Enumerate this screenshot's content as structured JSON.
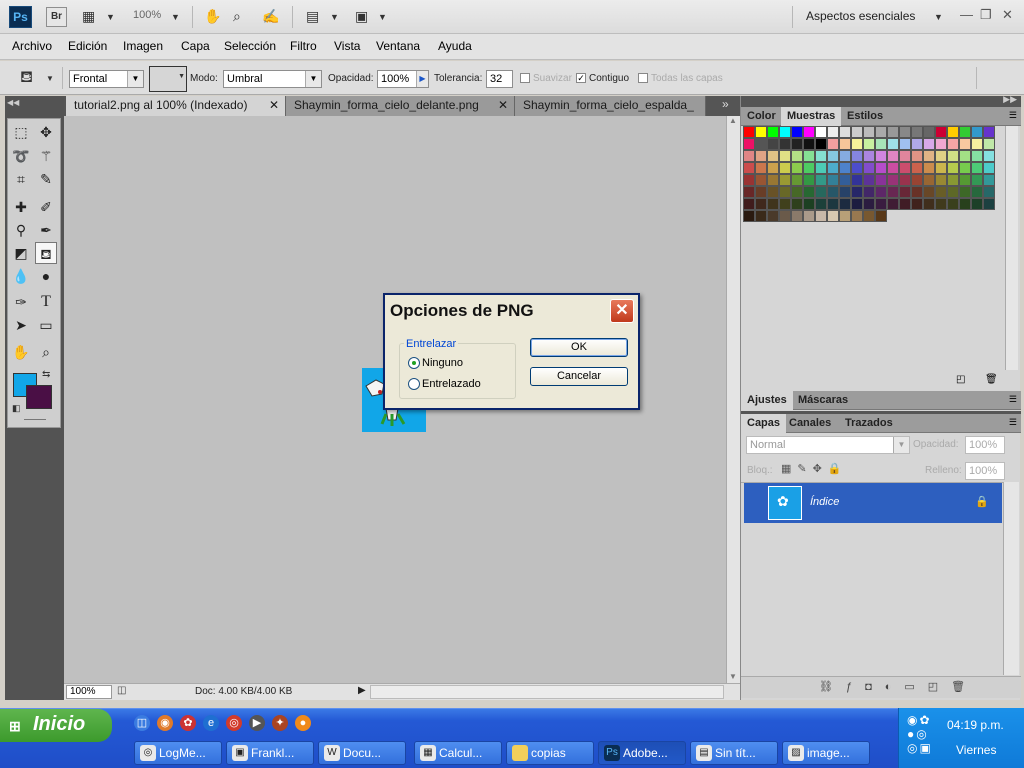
{
  "app": {
    "ps_badge": "Ps",
    "br_badge": "Br",
    "zoom": "100%",
    "workspace": "Aspectos esenciales"
  },
  "menu": [
    "Archivo",
    "Edición",
    "Imagen",
    "Capa",
    "Selección",
    "Filtro",
    "Vista",
    "Ventana",
    "Ayuda"
  ],
  "options": {
    "fill_source": "Frontal",
    "mode_label": "Modo:",
    "mode_value": "Umbral",
    "opacity_label": "Opacidad:",
    "opacity_value": "100%",
    "tolerance_label": "Tolerancia:",
    "tolerance_value": "32",
    "antialias_label": "Suavizar",
    "contiguous_label": "Contiguo",
    "all_layers_label": "Todas las capas"
  },
  "doc_tabs": [
    {
      "label": "tutorial2.png al 100% (Indexado)",
      "active": true
    },
    {
      "label": "Shaymin_forma_cielo_delante.png",
      "active": false
    },
    {
      "label": "Shaymin_forma_cielo_espalda_",
      "active": false
    }
  ],
  "status": {
    "zoom": "100%",
    "doc": "Doc: 4.00 KB/4.00 KB"
  },
  "colors": {
    "foreground": "#11a6e8",
    "background": "#4a0f45",
    "layer_selected": "#2d5fbf"
  },
  "panels": {
    "swatch_tabs": [
      "Color",
      "Muestras",
      "Estilos"
    ],
    "adjust_tabs": [
      "Ajustes",
      "Máscaras"
    ],
    "layer_tabs": [
      "Capas",
      "Canales",
      "Trazados"
    ],
    "blend_mode": "Normal",
    "opacity_label": "Opacidad:",
    "opacity_value": "100%",
    "lock_label": "Bloq.:",
    "fill_label": "Relleno:",
    "fill_value": "100%",
    "layer_name": "Índice"
  },
  "dialog": {
    "title": "Opciones de PNG",
    "group_label": "Entrelazar",
    "option_none": "Ninguno",
    "option_interlaced": "Entrelazado",
    "ok": "OK",
    "cancel": "Cancelar"
  },
  "taskbar": {
    "start": "Inicio",
    "tasks": [
      "LogMe...",
      "Frankl...",
      "Docu...",
      "Calcul...",
      "copias",
      "Adobe...",
      "Sin tít...",
      "image..."
    ],
    "time": "04:19 p.m.",
    "day": "Viernes"
  }
}
